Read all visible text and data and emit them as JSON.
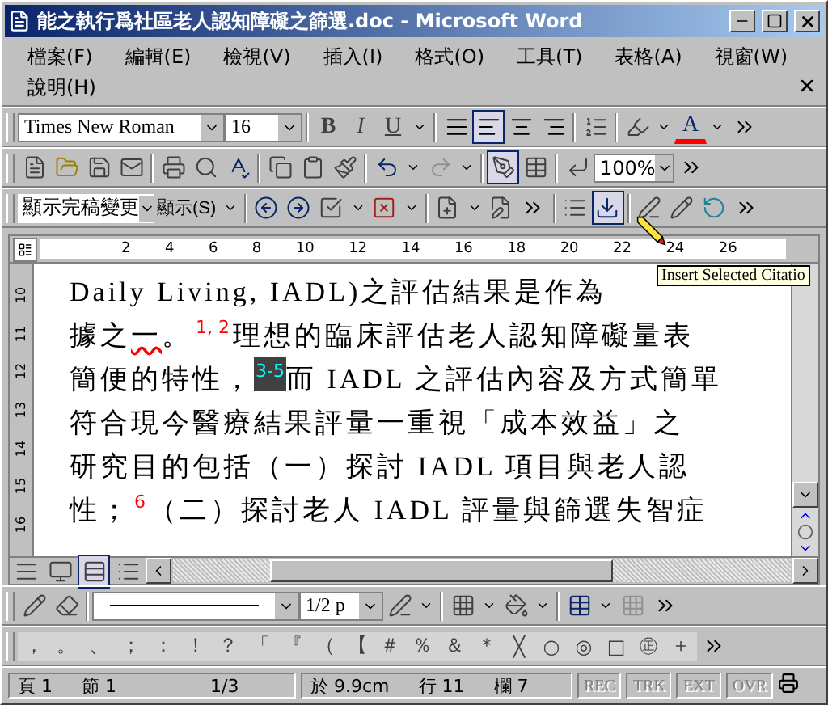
{
  "window": {
    "title": "能之執行爲社區老人認知障礙之篩選.doc - Microsoft Word"
  },
  "menu": {
    "items": [
      "檔案(F)",
      "編輯(E)",
      "檢視(V)",
      "插入(I)",
      "格式(O)",
      "工具(T)",
      "表格(A)",
      "視窗(W)",
      "說明(H)"
    ]
  },
  "formatting_toolbar": {
    "font": "Times New Roman",
    "size": "16",
    "style_buttons": [
      {
        "label": "B",
        "kind": "bold"
      },
      {
        "label": "I",
        "kind": "italic"
      },
      {
        "label": "U",
        "kind": "underline"
      }
    ],
    "align_buttons": [
      {
        "kind": "justify",
        "selected": false
      },
      {
        "kind": "left",
        "selected": true
      },
      {
        "kind": "center",
        "selected": false
      },
      {
        "kind": "right",
        "selected": false
      }
    ],
    "font_color_label": "A"
  },
  "standard_toolbar": {
    "zoom": "100%",
    "tables_selected": true
  },
  "reviewing_toolbar": {
    "display": "顯示完稿變更",
    "show_menu": "顯示(S)",
    "citation_button_selected": true
  },
  "ruler": {
    "labels": [
      "2",
      "4",
      "6",
      "8",
      "10",
      "12",
      "14",
      "16",
      "18",
      "20",
      "22",
      "24",
      "26"
    ]
  },
  "vertical_ruler": {
    "labels": [
      "10",
      "11",
      "12",
      "13",
      "14",
      "15",
      "16"
    ]
  },
  "tooltip": "Insert Selected Citatio",
  "document": {
    "lines": [
      [
        {
          "kind": "text",
          "text": "Daily Living, IADL)之評估結果是作為"
        }
      ],
      [
        {
          "kind": "text",
          "text": "據之"
        },
        {
          "kind": "flagged",
          "text": "一"
        },
        {
          "kind": "text",
          "text": "。"
        },
        {
          "kind": "citation",
          "text": "1, 2"
        },
        {
          "kind": "text",
          "text": "理想的臨床評估老人認知障礙量表"
        }
      ],
      [
        {
          "kind": "text",
          "text": "簡便的特性，"
        },
        {
          "kind": "citation-selected",
          "text": "3-5"
        },
        {
          "kind": "text",
          "text": "而 IADL 之評估內容及方式簡單"
        }
      ],
      [
        {
          "kind": "text",
          "text": "符合現今醫療結果評量一重視「成本效益」之"
        }
      ],
      [
        {
          "kind": "text",
          "text": "研究目的包括（一）探討 IADL 項目與老人認"
        }
      ],
      [
        {
          "kind": "text",
          "text": "性；"
        },
        {
          "kind": "citation",
          "text": "6"
        },
        {
          "kind": "text",
          "text": "（二）探討老人 IADL 評量與篩選失智症"
        }
      ]
    ]
  },
  "drawing_toolbar": {
    "line_weight": "1/2 p"
  },
  "symbols": [
    "，",
    "。",
    "、",
    "；",
    "：",
    "！",
    "？",
    "「",
    "『",
    "（",
    "【",
    "＃",
    "％",
    "＆",
    "＊",
    "╳",
    "○",
    "◎",
    "□",
    "㊣",
    "＋"
  ],
  "status_bar": {
    "page": "頁 1",
    "section": "節 1",
    "pages": "1/3",
    "position": "於 9.9cm",
    "line": "行 11",
    "column": "欄 7",
    "modes": [
      {
        "label": "REC",
        "disabled": true
      },
      {
        "label": "TRK",
        "disabled": true
      },
      {
        "label": "EXT",
        "disabled": true
      },
      {
        "label": "OVR",
        "disabled": true
      }
    ]
  }
}
